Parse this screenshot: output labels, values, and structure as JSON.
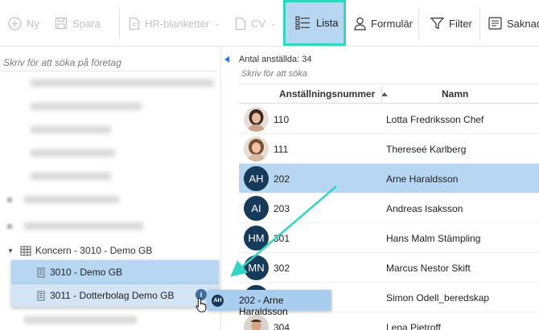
{
  "toolbar": {
    "new_label": "Ny",
    "save_label": "Spara",
    "hr_forms_label": "HR-blanketter",
    "cv_label": "CV",
    "list_label": "Lista",
    "form_label": "Formulär",
    "filter_label": "Filter",
    "missing_label": "Saknade"
  },
  "left_panel": {
    "search_placeholder": "Skriv för att söka på företag",
    "koncern_label": "Koncern - 3010 - Demo GB",
    "companies": [
      {
        "label": "3010 - Demo GB"
      },
      {
        "label": "3011 - Dotterbolag Demo GB"
      }
    ]
  },
  "grid": {
    "count_text": "Antal anställda: 34",
    "search_placeholder": "Skriv för att söka",
    "col_number": "Anställningsnummer",
    "col_name": "Namn",
    "rows": [
      {
        "number": "110",
        "name": "Lotta Fredriksson Chef",
        "initials": "",
        "photo": true
      },
      {
        "number": "111",
        "name": "Thereseé Karlberg",
        "initials": "",
        "photo": true
      },
      {
        "number": "202",
        "name": "Arne Haraldsson",
        "initials": "AH",
        "photo": false
      },
      {
        "number": "203",
        "name": "Andreas Isaksson",
        "initials": "AI",
        "photo": false
      },
      {
        "number": "301",
        "name": "Hans Malm Stämpling",
        "initials": "HM",
        "photo": false
      },
      {
        "number": "302",
        "name": "Marcus Nestor Skift",
        "initials": "MN",
        "photo": false
      },
      {
        "number": "",
        "name": "Simon Odell_beredskap",
        "initials": "",
        "photo": false
      },
      {
        "number": "304",
        "name": "Lena Pietroff",
        "initials": "",
        "photo": true
      }
    ]
  },
  "drag": {
    "badge": "AH",
    "label": "202 - Arne Haraldsson",
    "info": "i"
  },
  "colors": {
    "accent": "#2fd6c0",
    "selected_row": "#b7d6f1",
    "avatar_bg": "#163a59"
  }
}
